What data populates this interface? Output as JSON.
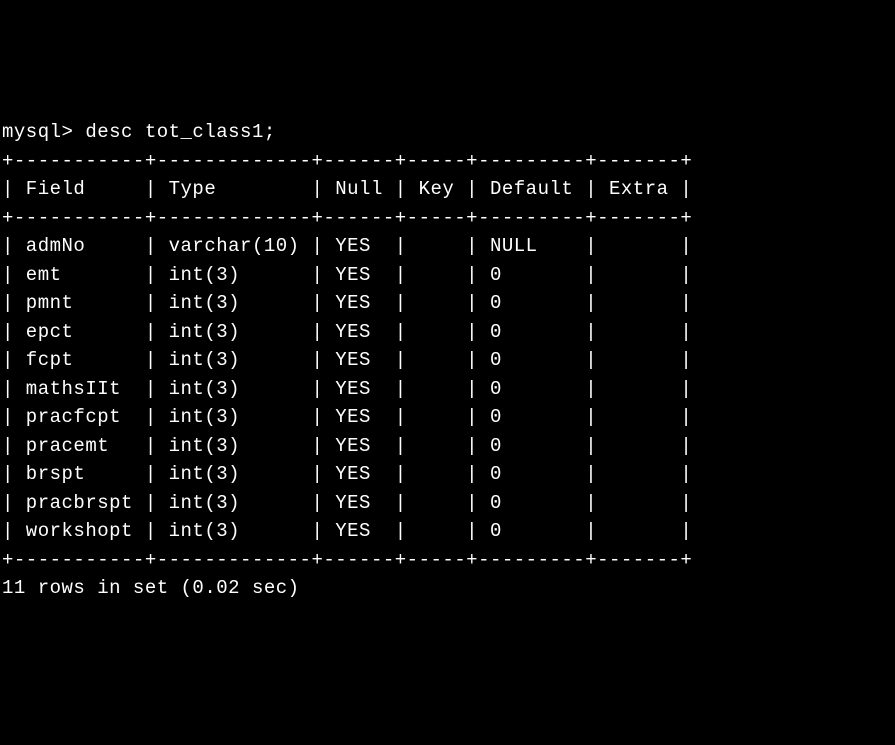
{
  "prompt": "mysql>",
  "command": "desc tot_class1;",
  "headers": {
    "field": "Field",
    "type": "Type",
    "null": "Null",
    "key": "Key",
    "default": "Default",
    "extra": "Extra"
  },
  "rows": [
    {
      "field": "admNo",
      "type": "varchar(10)",
      "null": "YES",
      "key": "",
      "default": "NULL",
      "extra": ""
    },
    {
      "field": "emt",
      "type": "int(3)",
      "null": "YES",
      "key": "",
      "default": "0",
      "extra": ""
    },
    {
      "field": "pmnt",
      "type": "int(3)",
      "null": "YES",
      "key": "",
      "default": "0",
      "extra": ""
    },
    {
      "field": "epct",
      "type": "int(3)",
      "null": "YES",
      "key": "",
      "default": "0",
      "extra": ""
    },
    {
      "field": "fcpt",
      "type": "int(3)",
      "null": "YES",
      "key": "",
      "default": "0",
      "extra": ""
    },
    {
      "field": "mathsIIt",
      "type": "int(3)",
      "null": "YES",
      "key": "",
      "default": "0",
      "extra": ""
    },
    {
      "field": "pracfcpt",
      "type": "int(3)",
      "null": "YES",
      "key": "",
      "default": "0",
      "extra": ""
    },
    {
      "field": "pracemt",
      "type": "int(3)",
      "null": "YES",
      "key": "",
      "default": "0",
      "extra": ""
    },
    {
      "field": "brspt",
      "type": "int(3)",
      "null": "YES",
      "key": "",
      "default": "0",
      "extra": ""
    },
    {
      "field": "pracbrspt",
      "type": "int(3)",
      "null": "YES",
      "key": "",
      "default": "0",
      "extra": ""
    },
    {
      "field": "workshopt",
      "type": "int(3)",
      "null": "YES",
      "key": "",
      "default": "0",
      "extra": ""
    }
  ],
  "footer": "11 rows in set (0.02 sec)",
  "separator": "+-----------+-------------+------+-----+---------+-------+",
  "col_widths": {
    "field": 11,
    "type": 13,
    "null": 6,
    "key": 5,
    "default": 9,
    "extra": 7
  }
}
